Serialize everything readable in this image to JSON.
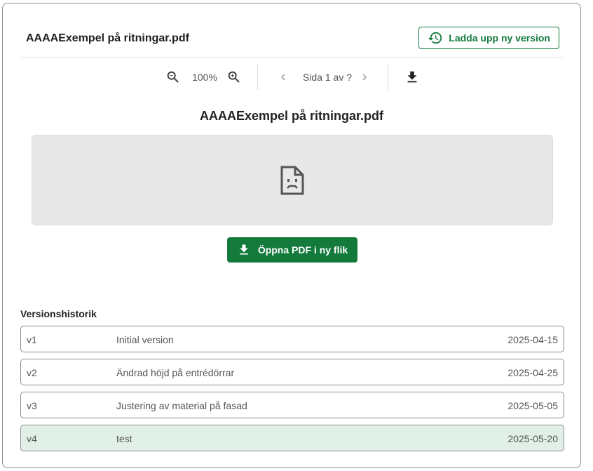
{
  "header": {
    "file_name": "AAAAExempel på ritningar.pdf",
    "upload_label": "Ladda upp ny version"
  },
  "toolbar": {
    "zoom_level": "100%",
    "page_indicator": "Sida 1 av ?"
  },
  "viewer": {
    "document_title": "AAAAExempel på ritningar.pdf",
    "status_icon": "broken-document-icon"
  },
  "open_button": {
    "label": "Öppna PDF i ny flik"
  },
  "version_history": {
    "title": "Versionshistorik",
    "items": [
      {
        "version": "v1",
        "description": "Initial version",
        "date": "2025-04-15"
      },
      {
        "version": "v2",
        "description": "Ändrad höjd på entrédörrar",
        "date": "2025-04-25"
      },
      {
        "version": "v3",
        "description": "Justering av material på fasad",
        "date": "2025-05-05"
      },
      {
        "version": "v4",
        "description": "test",
        "date": "2025-05-20",
        "selected": true
      }
    ]
  },
  "colors": {
    "accent": "#137a3c",
    "selected_row_bg": "#e1f0e7",
    "viewer_bg": "#e8e8e8"
  }
}
